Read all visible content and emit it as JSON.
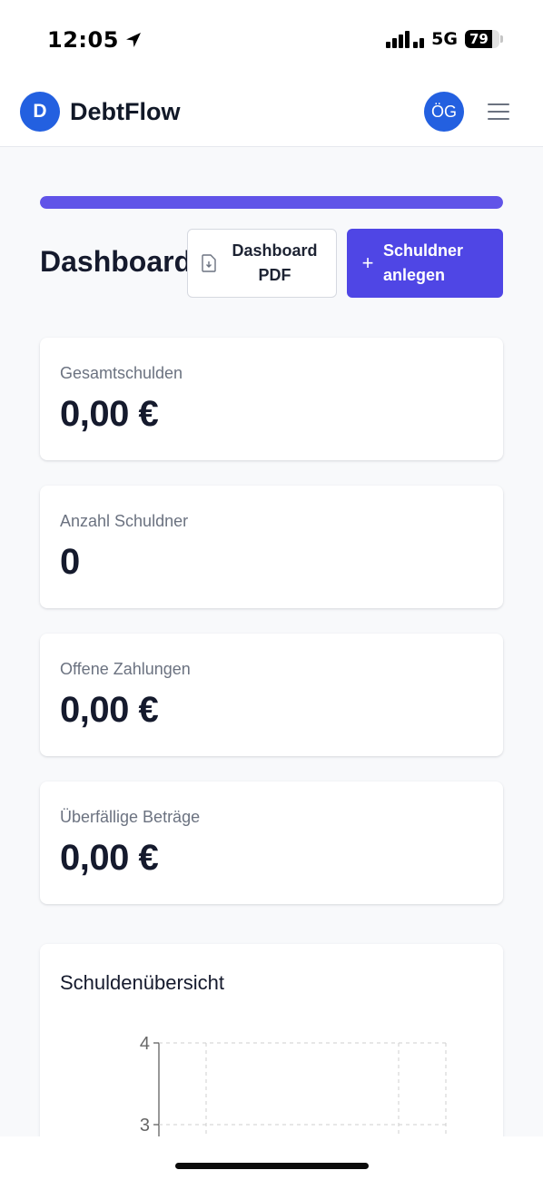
{
  "status_bar": {
    "time": "12:05",
    "network": "5G",
    "battery_level": "79",
    "location_icon": "location-arrow-icon",
    "signal_icon": "signal-bars-icon"
  },
  "header": {
    "logo_letter": "D",
    "brand": "DebtFlow",
    "user_initials": "ÖG",
    "menu_icon": "hamburger-menu-icon"
  },
  "progress": {
    "fraction": 1.0,
    "color": "#6154e8"
  },
  "page": {
    "title": "Dashboard",
    "pdf_button": {
      "line1": "Dashboard",
      "line2": "PDF",
      "icon": "file-download-icon"
    },
    "new_button": {
      "line1": "Schuldner",
      "line2": "anlegen",
      "icon": "plus-icon",
      "color": "#4f46e5"
    }
  },
  "stats": [
    {
      "label": "Gesamtschulden",
      "value": "0,00 €"
    },
    {
      "label": "Anzahl Schuldner",
      "value": "0"
    },
    {
      "label": "Offene Zahlungen",
      "value": "0,00 €"
    },
    {
      "label": "Überfällige Beträge",
      "value": "0,00 €"
    }
  ],
  "chart": {
    "title": "Schuldenübersicht"
  },
  "chart_data": {
    "type": "line",
    "title": "Schuldenübersicht",
    "xlabel": "",
    "ylabel": "",
    "y_ticks": [
      4,
      3
    ],
    "series": [],
    "grid": true
  },
  "colors": {
    "accent": "#4f46e5",
    "brand_blue": "#2360e0",
    "text_dark": "#151a2d",
    "text_muted": "#6b7280"
  }
}
